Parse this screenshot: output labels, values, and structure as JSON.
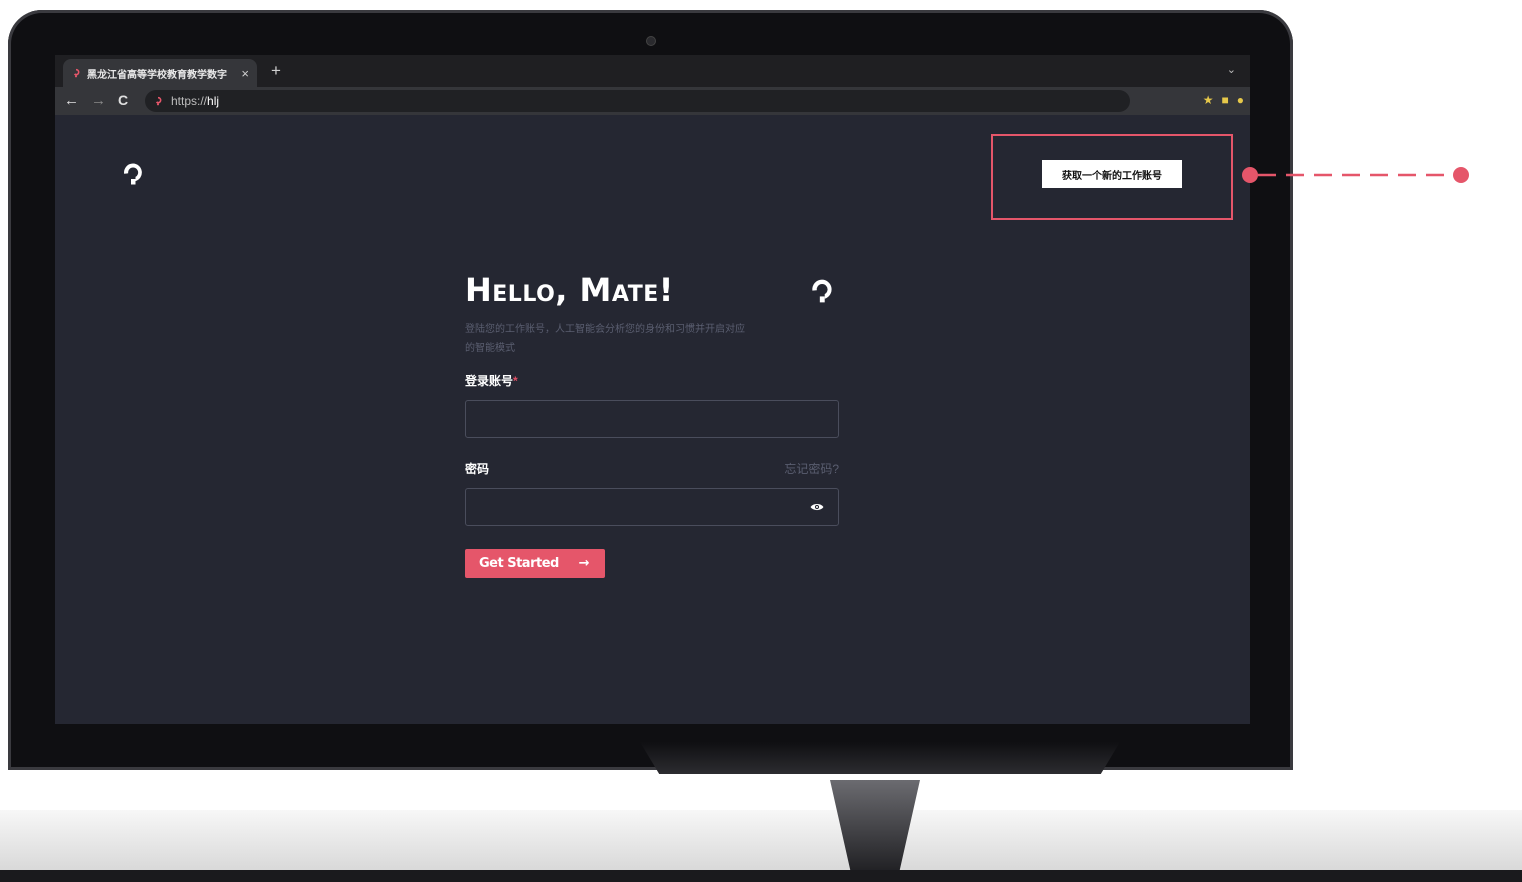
{
  "browser": {
    "tab_title": "黑龙江省高等学校教育教学数字",
    "tab_close": "×",
    "new_tab": "+",
    "tab_menu": "⌄",
    "url_prefix": "https://",
    "url_host": "hlj",
    "nav_back": "←",
    "nav_forward": "→",
    "nav_reload": "C"
  },
  "page": {
    "get_account_button": "获取一个新的工作账号",
    "title": "Hello, Mate!",
    "subtitle": "登陆您的工作账号，人工智能会分析您的身份和习惯并开启对应的智能模式",
    "account_label": "登录账号",
    "required_mark": "*",
    "password_label": "密码",
    "forgot_password": "忘记密码?",
    "start_button": "Get Started",
    "start_arrow": "→"
  },
  "colors": {
    "accent": "#e5566a",
    "background": "#252732",
    "banner": "#4a0a0c"
  },
  "icons": {
    "logo": "logo-icon",
    "eye": "eye-icon"
  }
}
